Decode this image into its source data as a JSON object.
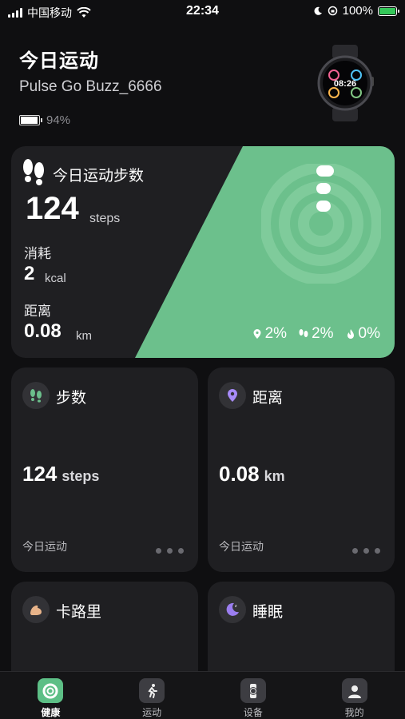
{
  "status_bar": {
    "carrier": "中国移动",
    "time": "22:34",
    "battery": "100%"
  },
  "header": {
    "title": "今日运动",
    "device_name": "Pulse Go Buzz_6666",
    "device_battery": "94%"
  },
  "watch_face": {
    "time": "08:26"
  },
  "hero": {
    "title": "今日运动步数",
    "steps_value": "124",
    "steps_unit": "steps",
    "calories_label": "消耗",
    "calories_value": "2",
    "calories_unit": "kcal",
    "distance_label": "距离",
    "distance_value": "0.08",
    "distance_unit": "km",
    "stats": [
      "2%",
      "2%",
      "0%"
    ],
    "accent_color": "#6cc08c"
  },
  "tiles": [
    {
      "title": "步数",
      "value": "124",
      "unit": "steps",
      "footer": "今日运动",
      "icon": "footprints-icon"
    },
    {
      "title": "距离",
      "value": "0.08",
      "unit": "km",
      "footer": "今日运动",
      "icon": "location-pin-icon"
    },
    {
      "title": "卡路里",
      "icon": "arm-icon"
    },
    {
      "title": "睡眠",
      "icon": "moon-icon"
    }
  ],
  "tabbar": {
    "items": [
      {
        "label": "健康",
        "icon": "health-ring-icon",
        "active": true
      },
      {
        "label": "运动",
        "icon": "running-icon",
        "active": false
      },
      {
        "label": "设备",
        "icon": "watch-icon",
        "active": false
      },
      {
        "label": "我的",
        "icon": "profile-icon",
        "active": false
      }
    ]
  }
}
